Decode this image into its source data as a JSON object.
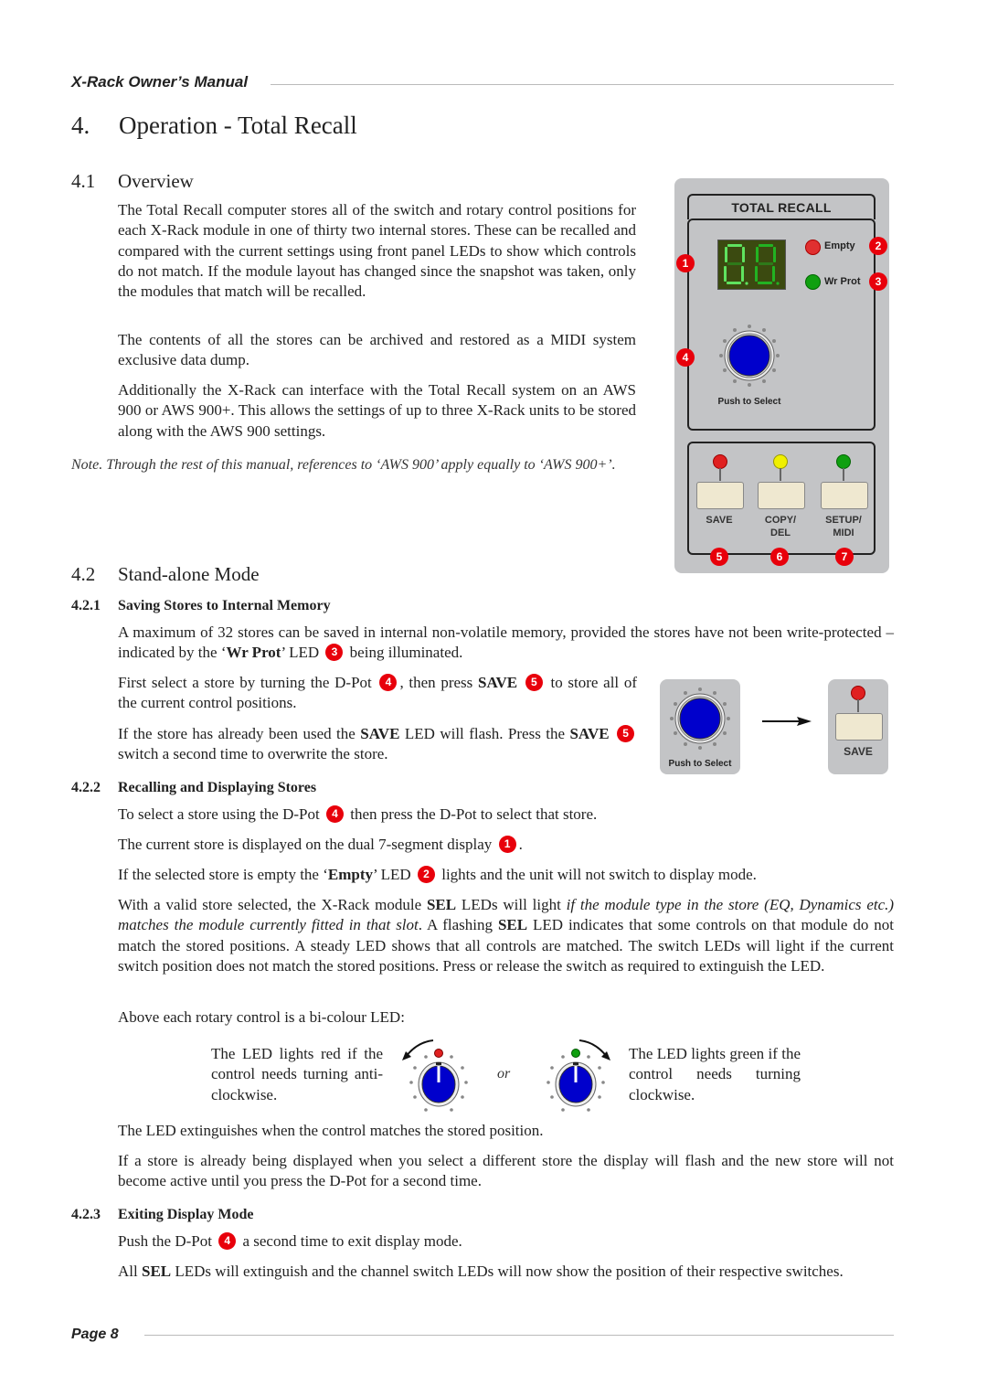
{
  "header": {
    "title": "X-Rack Owner’s Manual"
  },
  "footer": {
    "page": "Page 8"
  },
  "section4": {
    "num": "4.",
    "title": "Operation - Total Recall"
  },
  "s41": {
    "num": "4.1",
    "title": "Overview",
    "p1": "The Total Recall computer stores all of the switch and rotary control positions for each X-Rack module in one of thirty two internal stores. These can be recalled and compared with the current settings using front panel LEDs to show which controls do not match. If the module layout has changed since the snapshot was taken, only the modules that match will be recalled.",
    "p2": "The contents of all the stores can be archived and restored as a MIDI system exclusive data dump.",
    "p3": "Additionally the X-Rack can interface with the Total Recall system on an AWS 900 or AWS 900+. This allows the settings of up to three X-Rack units to be stored along with the AWS 900 settings.",
    "note_label": "Note.",
    "note": "Through the rest of this manual, references to ‘AWS 900’ apply equally to ‘AWS 900+’."
  },
  "panel": {
    "title": "TOTAL RECALL",
    "empty_label": "Empty",
    "wrprot_label": "Wr Prot",
    "push_label": "Push to Select",
    "buttons": [
      {
        "line1": "SAVE",
        "line2": "",
        "led_color": "#e02020"
      },
      {
        "line1": "COPY/",
        "line2": "DEL",
        "led_color": "#f0f000"
      },
      {
        "line1": "SETUP/",
        "line2": "MIDI",
        "led_color": "#10a010"
      }
    ],
    "callouts": [
      "1",
      "2",
      "3",
      "4",
      "5",
      "6",
      "7"
    ],
    "colors": {
      "panel": "#c3c4c6",
      "knob": "#0000cc",
      "display": "#3b4a10",
      "segment": "#4cd84c",
      "callout": "#e8000b"
    }
  },
  "s42": {
    "num": "4.2",
    "title": "Stand-alone Mode"
  },
  "s421": {
    "num": "4.2.1",
    "title": "Saving Stores to Internal Memory",
    "p1a": "A maximum of 32 stores can be saved in internal non-volatile memory, provided the stores have not been write-protected – indicated by the ‘",
    "p1b": "Wr Prot",
    "p1c": "’ LED",
    "p1d": "being illuminated.",
    "p2a": "First select a store by turning the D-Pot",
    "p2b": ", then press",
    "p2c": "SAVE",
    "p2d": "to store all of the current control positions.",
    "p3a": "If the store has already been used the",
    "p3b": "SAVE",
    "p3c": "LED will flash. Press the",
    "p3d": "SAVE",
    "p3e": "switch a second time to overwrite the store.",
    "fig_push_label": "Push to Select",
    "fig_save_label": "SAVE"
  },
  "s422": {
    "num": "4.2.2",
    "title": "Recalling and Displaying Stores",
    "p1a": "To select a store using the D-Pot",
    "p1b": "then press the D-Pot to select that store.",
    "p2a": "The current store is displayed on the dual 7-segment display",
    "p2b": ".",
    "p3a": "If the selected store is empty the ‘",
    "p3b": "Empty",
    "p3c": "’ LED",
    "p3d": "lights and the unit will not switch to display mode.",
    "p4a": "With a valid store selected, the X-Rack module",
    "p4b": "SEL",
    "p4c": "LEDs will light",
    "p4d": "if the module type in the store (EQ, Dynamics etc.) matches the module currently fitted in that slot",
    "p4e": ". A flashing",
    "p4f": "SEL",
    "p4g": "LED indicates that some controls on that module do not match the stored positions. A steady LED shows that all controls are matched. The switch LEDs will light if the current switch position does not match the stored positions. Press or release the switch as required to extinguish the LED.",
    "p5": "Above each rotary control is a bi-colour LED:",
    "red_text": "The LED lights red if the control needs turning anti-clockwise.",
    "or": "or",
    "green_text": "The LED lights green if the control needs turning clockwise.",
    "p6": "The LED extinguishes when the control matches the stored position.",
    "p7": "If a store is already being displayed when you select a different store the display will flash and the new store will not become active until you press the D-Pot for a second time."
  },
  "s423": {
    "num": "4.2.3",
    "title": "Exiting Display Mode",
    "p1a": "Push the D-Pot",
    "p1b": "a second time to exit display mode.",
    "p2a": "All",
    "p2b": "SEL",
    "p2c": "LEDs will extinguish and the channel switch LEDs will now show the position of their respective switches."
  }
}
